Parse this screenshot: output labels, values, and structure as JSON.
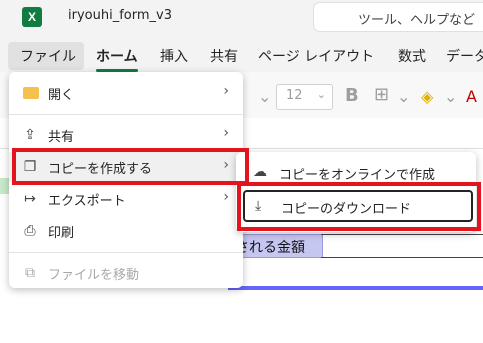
{
  "app": {
    "logo_letter": "X",
    "doc_title": "iryouhi_form_v3",
    "search_placeholder": "ツール、ヘルプなど"
  },
  "tabs": [
    "ファイル",
    "ホーム",
    "挿入",
    "共有",
    "ページ レイアウト",
    "数式",
    "データ"
  ],
  "toolbar": {
    "font_size": "12",
    "bold_label": "B"
  },
  "sheet": {
    "cell_text": "される金額"
  },
  "file_menu": {
    "items": [
      {
        "label": "開く",
        "icon": "folder-icon",
        "arrow": "›"
      },
      {
        "label": "共有",
        "icon": "share-icon",
        "arrow": "›"
      },
      {
        "label": "コピーを作成する",
        "icon": "copy-icon",
        "arrow": "›"
      },
      {
        "label": "エクスポート",
        "icon": "export-icon",
        "arrow": "›"
      },
      {
        "label": "印刷",
        "icon": "print-icon"
      },
      {
        "label": "ファイルを移動",
        "icon": "move-file-icon",
        "disabled": true
      }
    ]
  },
  "copy_submenu": {
    "items": [
      {
        "label": "コピーをオンラインで作成",
        "icon": "cloud-copy-icon"
      },
      {
        "label": "コピーのダウンロード",
        "icon": "download-icon"
      }
    ]
  },
  "colors": {
    "highlight_red": "#e3141d",
    "excel_green": "#107c41",
    "cell_purple": "#c6c6f2"
  }
}
